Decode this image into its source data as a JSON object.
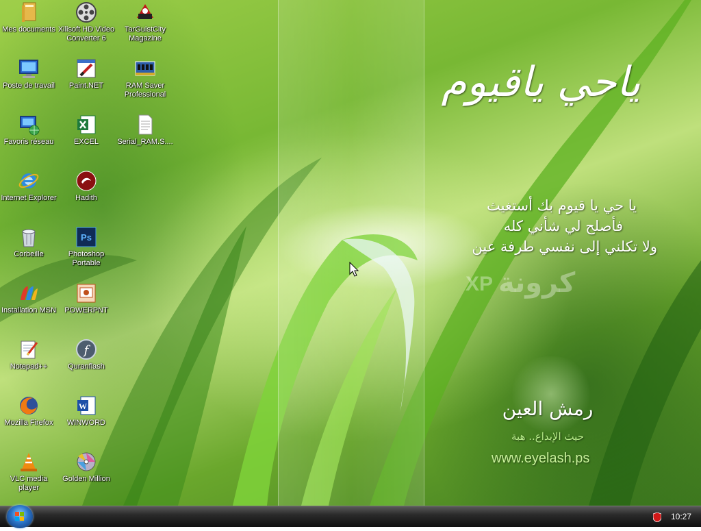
{
  "desktop": {
    "icons": [
      {
        "label": "Mes documents",
        "icon": "folder-icon"
      },
      {
        "label": "Xilisoft HD Video Converter 6",
        "icon": "film-reel-icon"
      },
      {
        "label": "TarGuistCity Magazine",
        "icon": "app-logo-icon"
      },
      {
        "label": "Poste de travail",
        "icon": "computer-icon"
      },
      {
        "label": "Paint.NET",
        "icon": "paint-icon"
      },
      {
        "label": "RAM Saver Professional",
        "icon": "ram-chip-icon"
      },
      {
        "label": "Favoris réseau",
        "icon": "network-icon"
      },
      {
        "label": "EXCEL",
        "icon": "excel-icon"
      },
      {
        "label": "Serial_RAM.S....",
        "icon": "text-file-icon"
      },
      {
        "label": "Internet Explorer",
        "icon": "internet-explorer-icon"
      },
      {
        "label": "Hadith",
        "icon": "hadith-icon"
      },
      {
        "label": "Corbeille",
        "icon": "recycle-bin-icon"
      },
      {
        "label": "Photoshop Portable",
        "icon": "photoshop-icon"
      },
      {
        "label": "Installation MSN",
        "icon": "msn-icon"
      },
      {
        "label": "POWERPNT",
        "icon": "powerpoint-icon"
      },
      {
        "label": "Notepad++",
        "icon": "notepad-icon"
      },
      {
        "label": "Quranflash",
        "icon": "flash-icon"
      },
      {
        "label": "Mozilla Firefox",
        "icon": "firefox-icon"
      },
      {
        "label": "WINWORD",
        "icon": "word-icon"
      },
      {
        "label": "VLC media player",
        "icon": "vlc-cone-icon"
      },
      {
        "label": "Golden Million",
        "icon": "disc-icon"
      }
    ]
  },
  "wallpaper": {
    "calligraphy": "ياحي ياقيوم",
    "line1": "يا حي يا قيوم بك أستغيث",
    "line2": "فأصلح لي شأني كله",
    "line3": "ولا تكلني إلى نفسي طرفة عين",
    "brand_xp": "XP",
    "brand_ar": "كرونة",
    "logo_ar": "رمش العين",
    "slogan": "حيث الإبداع.. هبة",
    "website": "www.eyelash.ps"
  },
  "taskbar": {
    "clock": "10:27",
    "start_icon": "windows-logo-icon",
    "tray_icon": "shield-icon"
  }
}
